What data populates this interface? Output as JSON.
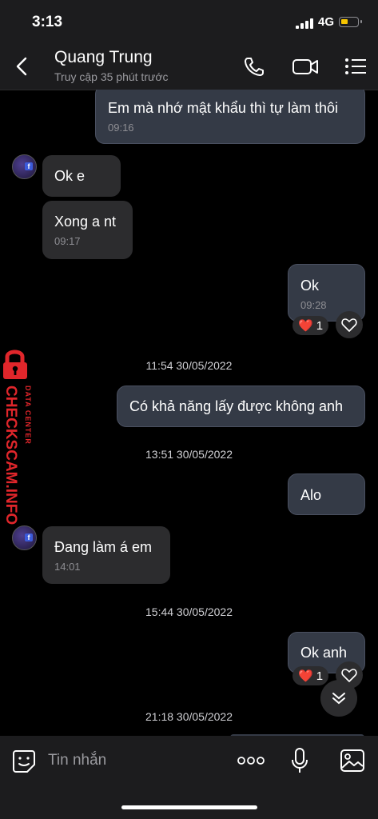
{
  "status_bar": {
    "time": "3:13",
    "network": "4G"
  },
  "header": {
    "name": "Quang Trung",
    "subtitle": "Truy cập 35 phút trước",
    "icons": [
      "back-icon",
      "phone-icon",
      "video-icon",
      "menu-icon"
    ]
  },
  "messages": [
    {
      "dir": "out",
      "text": "Em mà nhớ mật khẩu thì tự làm thôi",
      "time": "09:16"
    },
    {
      "dir": "in",
      "text": "Ok e",
      "time": ""
    },
    {
      "dir": "in",
      "text": "Xong a nt",
      "time": "09:17"
    },
    {
      "dir": "out",
      "text": "Ok",
      "time": "09:28",
      "reaction": {
        "emoji": "❤️",
        "count": "1"
      }
    },
    {
      "timestamp": "11:54 30/05/2022"
    },
    {
      "dir": "out",
      "text": "Có khả năng lấy được không anh",
      "time": ""
    },
    {
      "timestamp": "13:51 30/05/2022"
    },
    {
      "dir": "out",
      "text": "Alo",
      "time": ""
    },
    {
      "dir": "in",
      "text": "Đang làm á em",
      "time": "14:01"
    },
    {
      "timestamp": "15:44 30/05/2022"
    },
    {
      "dir": "out",
      "text": "Ok anh",
      "time": "",
      "reaction": {
        "emoji": "❤️",
        "count": "1"
      }
    },
    {
      "timestamp": "21:18 30/05/2022"
    }
  ],
  "watermark": {
    "top": "DATA CENTER",
    "main": "CHECKSCAM.INFO"
  },
  "input": {
    "placeholder": "Tin nhắn"
  },
  "colors": {
    "bar_bg": "#1c1c1e",
    "outgoing_bubble": "#343a46",
    "incoming_bubble": "#2c2c2e",
    "watermark_red": "#e0262b",
    "battery": "#f5c400"
  }
}
